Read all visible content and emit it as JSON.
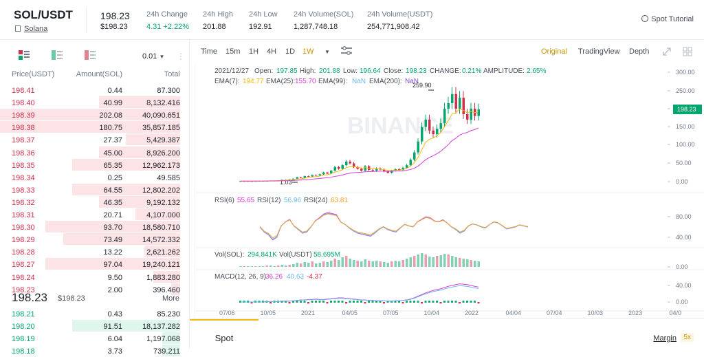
{
  "header": {
    "symbol": "SOL/USDT",
    "base_name": "Solana",
    "last_price": "198.23",
    "last_usd": "$198.23",
    "stats": [
      {
        "label": "24h Change",
        "value": "4.31 +2.22%",
        "color": "#03a66d"
      },
      {
        "label": "24h High",
        "value": "201.88"
      },
      {
        "label": "24h Low",
        "value": "192.91"
      },
      {
        "label": "24h Volume(SOL)",
        "value": "1,287,748.18"
      },
      {
        "label": "24h Volume(USDT)",
        "value": "254,771,908.42"
      }
    ],
    "tutorial": "Spot Tutorial"
  },
  "orderbook": {
    "precision": "0.01",
    "headers": [
      "Price(USDT)",
      "Amount(SOL)",
      "Total"
    ],
    "asks": [
      [
        "198.41",
        "0.44",
        "87.300",
        0
      ],
      [
        "198.40",
        "40.99",
        "8,132.416",
        0.45
      ],
      [
        "198.39",
        "202.08",
        "40,090.651",
        1
      ],
      [
        "198.38",
        "180.75",
        "35,857.185",
        1
      ],
      [
        "198.37",
        "27.37",
        "5,429.387",
        0.3
      ],
      [
        "198.36",
        "45.00",
        "8,926.200",
        0.45
      ],
      [
        "198.35",
        "65.35",
        "12,962.173",
        0.6
      ],
      [
        "198.34",
        "0.25",
        "49.585",
        0
      ],
      [
        "198.33",
        "64.55",
        "12,802.202",
        0.6
      ],
      [
        "198.32",
        "46.35",
        "9,192.132",
        0.45
      ],
      [
        "198.31",
        "20.71",
        "4,107.000",
        0.25
      ],
      [
        "198.30",
        "93.70",
        "18,580.710",
        0.75
      ],
      [
        "198.29",
        "73.49",
        "14,572.332",
        0.65
      ],
      [
        "198.28",
        "13.22",
        "2,621.262",
        0.2
      ],
      [
        "198.27",
        "97.04",
        "19,240.121",
        0.75
      ],
      [
        "198.24",
        "9.50",
        "1,883.280",
        0.15
      ],
      [
        "198.23",
        "2.00",
        "396.460",
        0.05
      ]
    ],
    "mid_price": "198.23",
    "mid_usd": "$198.23",
    "more": "More",
    "bids": [
      [
        "198.21",
        "0.43",
        "85.230",
        0
      ],
      [
        "198.20",
        "91.51",
        "18,137.282",
        0.6
      ],
      [
        "198.19",
        "6.04",
        "1,197.068",
        0.1
      ],
      [
        "198.18",
        "3.73",
        "739.211",
        0.1
      ]
    ]
  },
  "toolbar": {
    "intervals": [
      "Time",
      "15m",
      "1H",
      "4H",
      "1D",
      "1W"
    ],
    "active": "1W",
    "views": [
      "Original",
      "TradingView",
      "Depth"
    ]
  },
  "legend": {
    "date": "2021/12/27",
    "open_l": "Open:",
    "open": "197.85",
    "high_l": "High:",
    "high": "201.88",
    "low_l": "Low:",
    "low": "196.64",
    "close_l": "Close:",
    "close": "198.23",
    "chg_l": "CHANGE:",
    "chg": "0.21%",
    "amp_l": "AMPLITUDE:",
    "amp": "2.65%",
    "ema7_l": "EMA(7):",
    "ema7": "194.77",
    "ema25_l": "EMA(25):",
    "ema25": "155.70",
    "ema99_l": "EMA(99):",
    "ema99": "NaN",
    "ema200_l": "EMA(200):",
    "ema200": "NaN",
    "rsi6_l": "RSI(6)",
    "rsi6": "55.65",
    "rsi12_l": "RSI(12)",
    "rsi12": "56.96",
    "rsi24_l": "RSI(24)",
    "rsi24": "63.81",
    "vol_l": "Vol(SOL):",
    "vol": "294.841K",
    "volu_l": "Vol(USDT)",
    "volu": "58.695M",
    "macd_l": "MACD(12, 26, 9)",
    "macd1": "36.26",
    "macd2": "40.63",
    "macd3": "-4.37"
  },
  "chart_data": {
    "type": "candlestick",
    "price_axis": [
      "300.00",
      "250.00",
      "200.00",
      "150.00",
      "100.00",
      "50.00",
      "0.00"
    ],
    "price_tag": "198.23",
    "high_mark": "259.90",
    "low_mark": "1.03",
    "rsi_axis": [
      "80.00",
      "40.00"
    ],
    "vol_axis": [
      "0.00"
    ],
    "macd_axis": [
      "40.00",
      "0.00"
    ],
    "x_labels": [
      "07/06",
      "10/05",
      "2021",
      "04/05",
      "07/05",
      "10/04",
      "2022",
      "04/04",
      "07/04",
      "10/03",
      "2023",
      "04/0"
    ],
    "watermark": "BINANCE"
  },
  "bottom": {
    "spot": "Spot",
    "margin": "Margin",
    "margin_x": "5x"
  }
}
